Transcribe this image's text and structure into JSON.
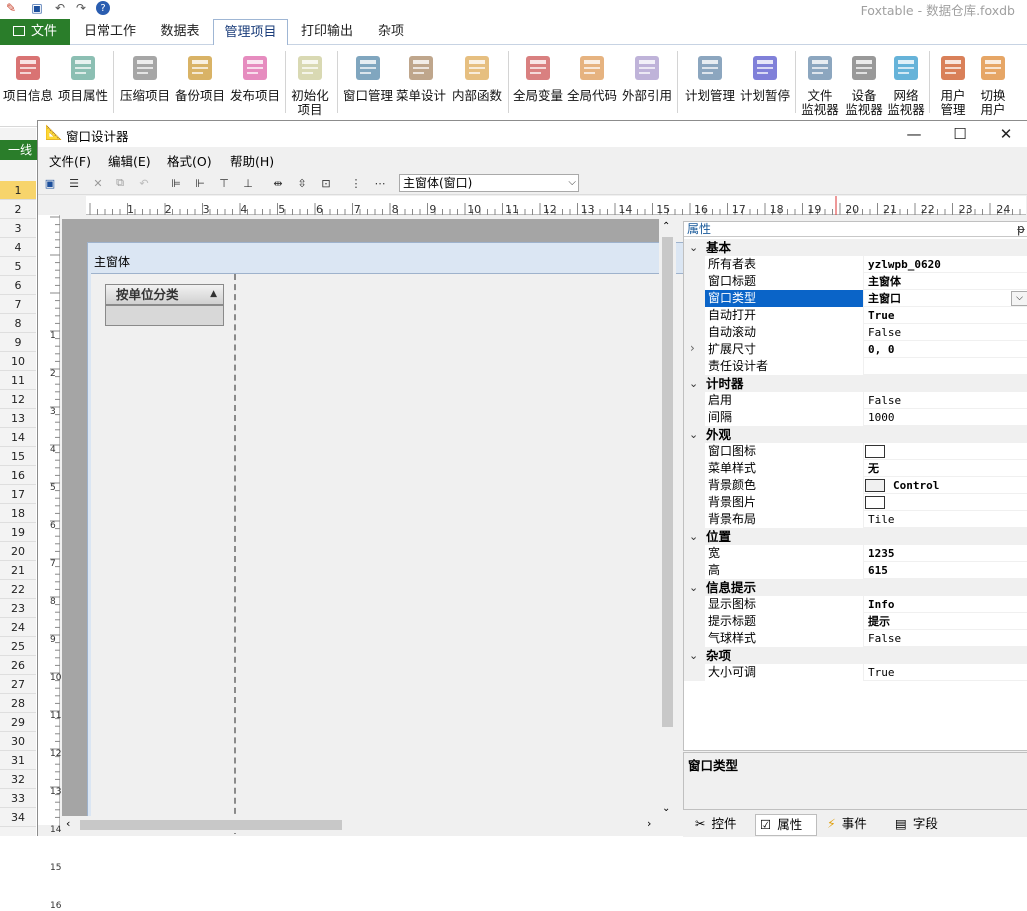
{
  "app": {
    "title": "Foxtable - 数据仓库.foxdb"
  },
  "ribbon_tabs": [
    "文件",
    "日常工作",
    "数据表",
    "管理项目",
    "打印输出",
    "杂项"
  ],
  "ribbon_buttons": [
    {
      "label": "项目信息",
      "icon": "project-info-icon"
    },
    {
      "label": "项目属性",
      "icon": "project-properties-icon"
    },
    {
      "label": "压缩项目",
      "icon": "compress-icon"
    },
    {
      "label": "备份项目",
      "icon": "backup-icon"
    },
    {
      "label": "发布项目",
      "icon": "publish-icon"
    },
    {
      "label": "初始化\n项目",
      "icon": "initialize-icon"
    },
    {
      "label": "窗口管理",
      "icon": "window-manager-icon"
    },
    {
      "label": "菜单设计",
      "icon": "menu-design-icon"
    },
    {
      "label": "内部函数",
      "icon": "internal-function-icon"
    },
    {
      "label": "全局变量",
      "icon": "global-variable-icon"
    },
    {
      "label": "全局代码",
      "icon": "global-code-icon"
    },
    {
      "label": "外部引用",
      "icon": "external-reference-icon"
    },
    {
      "label": "计划管理",
      "icon": "schedule-icon"
    },
    {
      "label": "计划暂停",
      "icon": "pause-icon"
    },
    {
      "label": "文件\n监视器",
      "icon": "file-monitor-icon"
    },
    {
      "label": "设备\n监视器",
      "icon": "device-monitor-icon"
    },
    {
      "label": "网络\n监视器",
      "icon": "network-monitor-icon"
    },
    {
      "label": "用户\n管理",
      "icon": "user-manage-icon"
    },
    {
      "label": "切换\n用户",
      "icon": "switch-user-icon"
    }
  ],
  "sheet": {
    "tab_label": "一线",
    "rows": [
      "1",
      "2",
      "3",
      "4",
      "5",
      "6",
      "7",
      "8",
      "9",
      "10",
      "11",
      "12",
      "13",
      "14",
      "15",
      "16",
      "17",
      "18",
      "19",
      "20",
      "21",
      "22",
      "23",
      "24",
      "25",
      "26",
      "27",
      "28",
      "29",
      "30",
      "31",
      "32",
      "33",
      "34"
    ]
  },
  "dialog": {
    "title": "窗口设计器",
    "menus": [
      "文件(F)",
      "编辑(E)",
      "格式(O)",
      "帮助(H)"
    ],
    "combo_value": "主窗体(窗口)",
    "hruler": [
      "1",
      "2",
      "3",
      "4",
      "5",
      "6",
      "7",
      "8",
      "9",
      "10",
      "11",
      "12",
      "13",
      "14",
      "15",
      "16",
      "17",
      "18",
      "19",
      "20",
      "21",
      "22",
      "23",
      "24"
    ],
    "vruler": [
      "1",
      "2",
      "3",
      "4",
      "5",
      "6",
      "7",
      "8",
      "9",
      "10",
      "11",
      "12",
      "13",
      "14",
      "15",
      "16"
    ],
    "form": {
      "caption": "主窗体",
      "group_header": "按单位分类"
    }
  },
  "properties": {
    "title": "属性",
    "pin": "ᵽ",
    "sections": [
      {
        "name": "基本",
        "rows": [
          {
            "name": "所有者表",
            "value": "yzlwpb_0620",
            "bold": true
          },
          {
            "name": "窗口标题",
            "value": "主窗体",
            "bold": true
          },
          {
            "name": "窗口类型",
            "value": "主窗口",
            "bold": true,
            "selected": true
          },
          {
            "name": "自动打开",
            "value": "True",
            "bold": true
          },
          {
            "name": "自动滚动",
            "value": "False",
            "bold": false
          },
          {
            "name": "扩展尺寸",
            "value": "0, 0",
            "bold": true,
            "expand": true
          },
          {
            "name": "责任设计者",
            "value": "",
            "bold": false
          }
        ]
      },
      {
        "name": "计时器",
        "rows": [
          {
            "name": "启用",
            "value": "False",
            "bold": false
          },
          {
            "name": "间隔",
            "value": "1000",
            "bold": false
          }
        ]
      },
      {
        "name": "外观",
        "rows": [
          {
            "name": "窗口图标",
            "value": "",
            "swatch": "#ffffff"
          },
          {
            "name": "菜单样式",
            "value": "无",
            "bold": true
          },
          {
            "name": "背景颜色",
            "value": "Control",
            "bold": true,
            "swatch": "#f0f0f0"
          },
          {
            "name": "背景图片",
            "value": "",
            "swatch": "#ffffff"
          },
          {
            "name": "背景布局",
            "value": "Tile",
            "bold": false
          }
        ]
      },
      {
        "name": "位置",
        "rows": [
          {
            "name": "宽",
            "value": "1235",
            "bold": true
          },
          {
            "name": "高",
            "value": "615",
            "bold": true
          }
        ]
      },
      {
        "name": "信息提示",
        "rows": [
          {
            "name": "显示图标",
            "value": "Info",
            "bold": true
          },
          {
            "name": "提示标题",
            "value": "提示",
            "bold": true
          },
          {
            "name": "气球样式",
            "value": "False",
            "bold": false
          }
        ]
      },
      {
        "name": "杂项",
        "rows": [
          {
            "name": "大小可调",
            "value": "True",
            "bold": false
          }
        ]
      }
    ],
    "description": "窗口类型"
  },
  "bottom_tabs": [
    {
      "label": "控件",
      "icon": "tools-icon"
    },
    {
      "label": "属性",
      "icon": "properties-icon",
      "active": true
    },
    {
      "label": "事件",
      "icon": "lightning-icon"
    },
    {
      "label": "字段",
      "icon": "fields-icon"
    }
  ],
  "colors": {
    "accent": "#2a7d2a",
    "selection": "#0a64c8"
  }
}
